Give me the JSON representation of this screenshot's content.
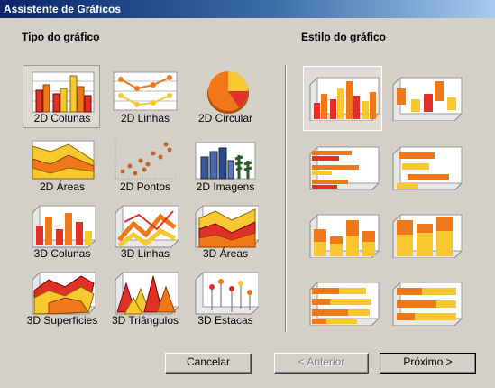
{
  "window": {
    "title": "Assistente de Gráficos"
  },
  "chart_types": {
    "title": "Tipo do gráfico",
    "selected": "2D Colunas",
    "items": [
      {
        "label": "2D Colunas",
        "icon": "2d-column-chart-icon"
      },
      {
        "label": "2D Linhas",
        "icon": "2d-line-chart-icon"
      },
      {
        "label": "2D Circular",
        "icon": "2d-pie-chart-icon"
      },
      {
        "label": "2D Áreas",
        "icon": "2d-area-chart-icon"
      },
      {
        "label": "2D Pontos",
        "icon": "2d-scatter-chart-icon"
      },
      {
        "label": "2D Imagens",
        "icon": "2d-image-chart-icon"
      },
      {
        "label": "3D Colunas",
        "icon": "3d-column-chart-icon"
      },
      {
        "label": "3D Linhas",
        "icon": "3d-line-chart-icon"
      },
      {
        "label": "3D Áreas",
        "icon": "3d-area-chart-icon"
      },
      {
        "label": "3D Superfícies",
        "icon": "3d-surface-chart-icon"
      },
      {
        "label": "3D Triângulos",
        "icon": "3d-triangle-chart-icon"
      },
      {
        "label": "3D Estacas",
        "icon": "3d-stake-chart-icon"
      }
    ]
  },
  "chart_styles": {
    "title": "Estilo do gráfico",
    "selected_index": 0,
    "items": [
      {
        "icon": "clustered-column-style-icon"
      },
      {
        "icon": "3d-floating-column-style-icon"
      },
      {
        "icon": "clustered-bar-style-icon"
      },
      {
        "icon": "3d-floating-bar-style-icon"
      },
      {
        "icon": "stacked-column-style-icon"
      },
      {
        "icon": "3d-stacked-column-style-icon"
      },
      {
        "icon": "stacked-bar-style-icon"
      },
      {
        "icon": "3d-stacked-bar-style-icon"
      }
    ]
  },
  "buttons": {
    "cancel": "Cancelar",
    "back": "< Anterior",
    "next": "Próximo >",
    "back_enabled": false
  },
  "colors": {
    "red": "#e03028",
    "orange": "#f07818",
    "yellow": "#f8c830",
    "titlebar": "#0a246a",
    "face": "#d4d0c8"
  }
}
